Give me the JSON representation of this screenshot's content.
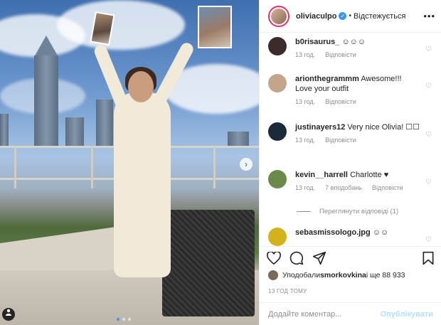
{
  "photo": {
    "next_arrow": "›",
    "tag_icon": "person-tag-icon",
    "carousel_dots": 3,
    "active_dot": 0
  },
  "header": {
    "username": "oliviaculpo",
    "verified_mark": "✓",
    "separator": "•",
    "follow_label": "Відстежується",
    "more_label": "•••"
  },
  "comments": [
    {
      "username": "b0risaurus_",
      "text": "☺☺☺",
      "time": "13 год.",
      "likes": "",
      "reply": "Відповісти",
      "avatar_color": "#3b2b2b"
    },
    {
      "username": "arionthegrammm",
      "text": "Awesome!!! Love your outfit",
      "time": "13 год.",
      "likes": "",
      "reply": "Відповісти",
      "avatar_color": "#c4a48a"
    },
    {
      "username": "justinayers12",
      "text": "Very nice Olivia! ☐☐",
      "time": "13 год.",
      "likes": "",
      "reply": "Відповісти",
      "avatar_color": "#1b2a3a"
    },
    {
      "username": "kevin__harrell",
      "text": "Charlotte ♥",
      "time": "13 год.",
      "likes": "7 вподобань",
      "reply": "Відповісти",
      "avatar_color": "#6b8a4a"
    },
    {
      "username": "sebasmissologo.jpg",
      "text": "☺☺",
      "time": "",
      "likes": "",
      "reply": "",
      "avatar_color": "#d4b21c"
    }
  ],
  "view_replies": "Переглянути відповіді (1)",
  "actions": {
    "like_icon": "heart-icon",
    "comment_icon": "comment-icon",
    "share_icon": "share-icon",
    "save_icon": "bookmark-icon"
  },
  "likes": {
    "prefix": "Уподобали ",
    "user": "smorkovkina",
    "suffix": " і ще 88 933"
  },
  "time_ago": "13 ГОД ТОМУ",
  "add_comment": {
    "placeholder": "Додайте коментар...",
    "publish_label": "Опублікувати"
  }
}
